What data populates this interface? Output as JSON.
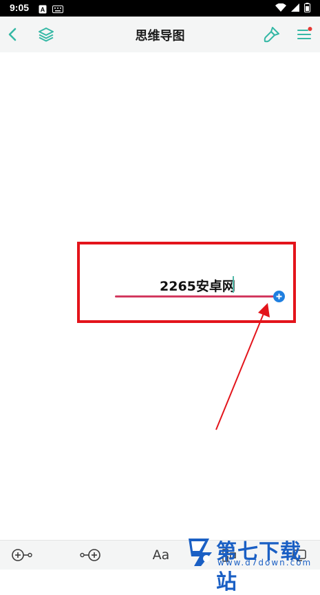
{
  "status_bar": {
    "time": "9:05",
    "icons": [
      "a-icon",
      "keyboard-icon",
      "wifi-icon",
      "signal-icon",
      "battery-icon"
    ]
  },
  "app_bar": {
    "title": "思维导图",
    "back_icon": "back-chevron-icon",
    "layers_icon": "layers-icon",
    "style_icon": "brush-icon",
    "menu_icon": "menu-icon",
    "menu_badge_color": "#e53935",
    "accent_color": "#35b8a5"
  },
  "canvas": {
    "node": {
      "text": "2265安卓网",
      "line_color": "#d2395f",
      "add_button_color": "#1f7fe0"
    },
    "annotation_color": "#e3141b"
  },
  "bottom_toolbar": {
    "items": [
      {
        "icon": "add-sibling-node-icon"
      },
      {
        "icon": "add-child-node-icon"
      },
      {
        "label": "Aa",
        "icon": "text-style-icon"
      },
      {
        "icon": "layout-icon"
      },
      {
        "icon": "more-icon"
      }
    ]
  },
  "watermark": {
    "title": "第七下载站",
    "url": "www.d7down.com",
    "color": "#1a5fc4"
  }
}
